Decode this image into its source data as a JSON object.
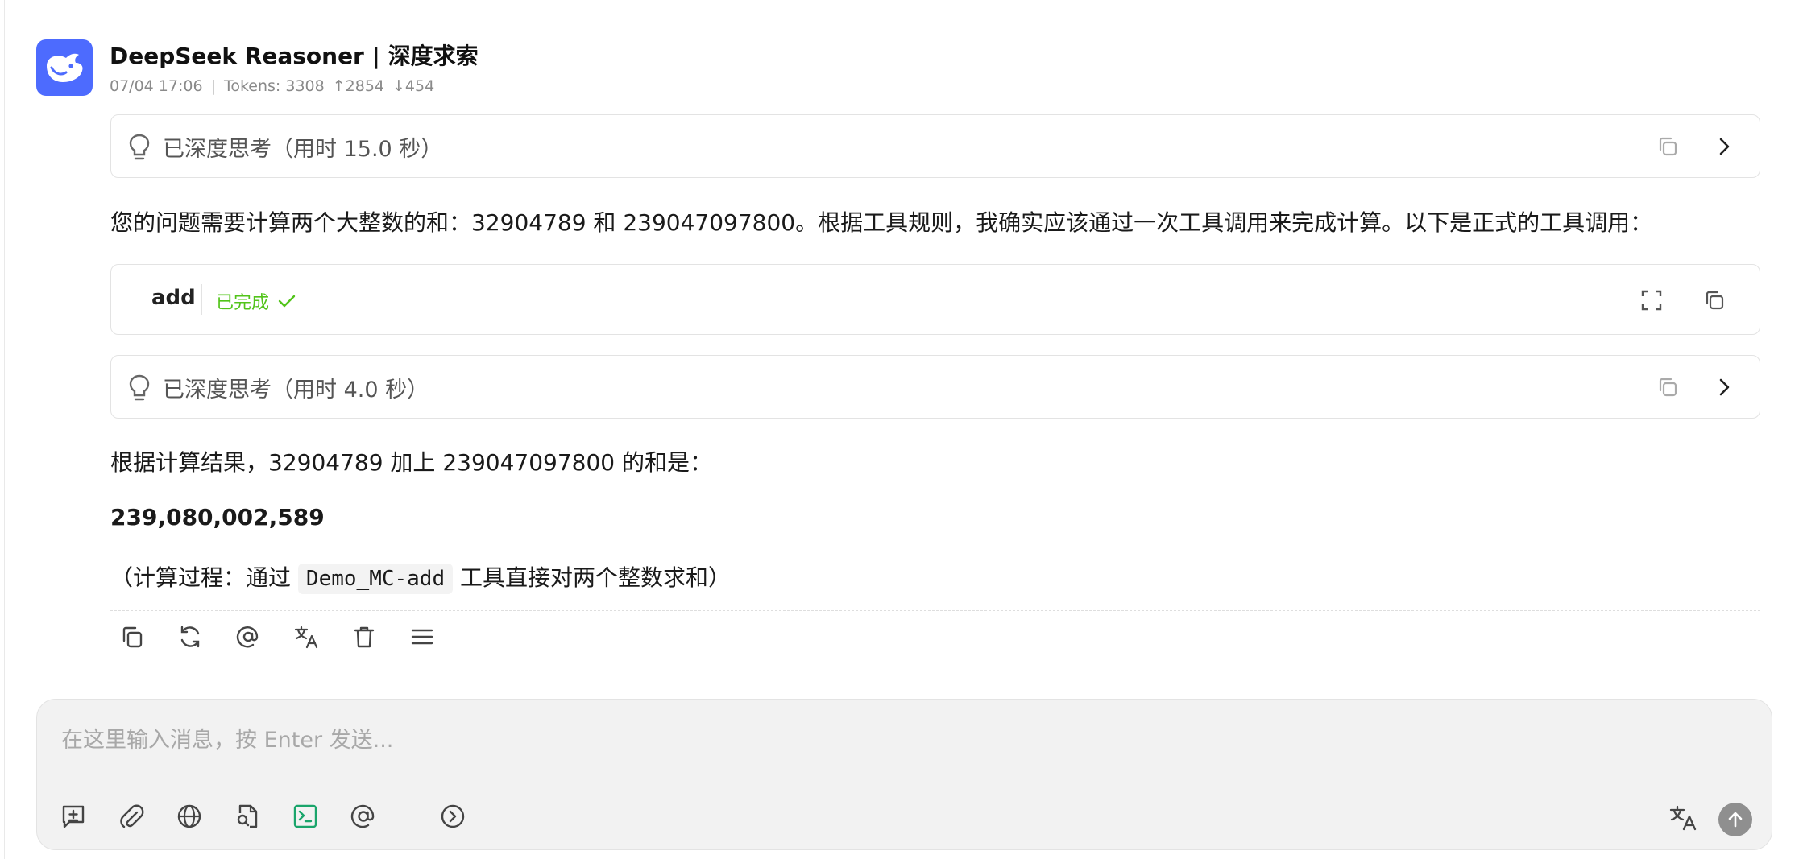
{
  "message": {
    "model_name": "DeepSeek Reasoner | 深度求索",
    "meta": {
      "timestamp": "07/04 17:06",
      "separator": "|",
      "tokens": "Tokens: 3308",
      "tokens_up": "↑2854",
      "tokens_down": "↓454"
    },
    "thinking_1": {
      "label": "已深度思考（用时 15.0 秒）"
    },
    "intro_text": "您的问题需要计算两个大整数的和：32904789 和 239047097800。根据工具规则，我确实应该通过一次工具调用来完成计算。以下是正式的工具调用：",
    "tool_call": {
      "name": "add",
      "status": "已完成"
    },
    "thinking_2": {
      "label": "已深度思考（用时 4.0 秒）"
    },
    "result_intro": "根据计算结果，32904789 加上 239047097800 的和是：",
    "result_value": "239,080,002,589",
    "process_prefix": "（计算过程：通过",
    "process_code": "Demo_MC-add",
    "process_suffix": "工具直接对两个整数求和）"
  },
  "message_actions": [
    "copy-icon",
    "regenerate-icon",
    "mention-icon",
    "translate-icon",
    "delete-icon",
    "menu-icon"
  ],
  "input": {
    "placeholder": "在这里输入消息，按 Enter 发送..."
  },
  "input_toolbar": [
    "new-topic-icon",
    "attachment-icon",
    "web-search-icon",
    "file-search-icon",
    "terminal-icon",
    "mention-icon",
    "more-icon"
  ],
  "colors": {
    "accent": "#4d6bfe",
    "success": "#52c41a",
    "terminal_green": "#1aa56b"
  }
}
